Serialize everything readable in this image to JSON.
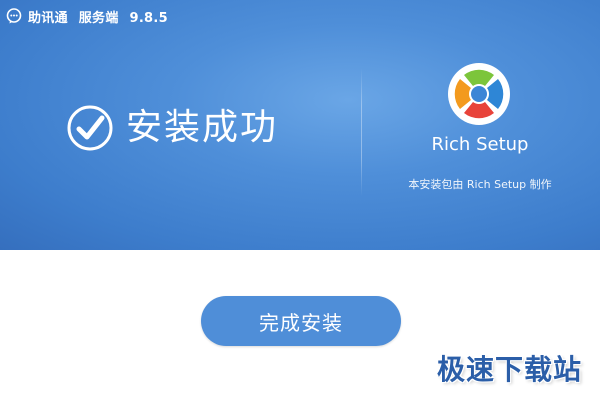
{
  "window": {
    "app_name": "助讯通",
    "edition": "服务端",
    "version": "9.8.5",
    "icon": "chat-bubble-icon"
  },
  "status": {
    "icon": "check-circle-icon",
    "text": "安装成功"
  },
  "brand": {
    "logo_icon": "rich-setup-logo-icon",
    "name": "Rich Setup",
    "credit": "本安装包由 Rich Setup 制作"
  },
  "actions": {
    "finish_label": "完成安装"
  },
  "watermark": {
    "text": "极速下载站"
  },
  "colors": {
    "header_blue": "#4f8fd9",
    "button_blue": "#4f8ed8",
    "background": "#ffffff",
    "watermark": "#2b5ea8",
    "logo_green": "#7cc53b",
    "logo_blue": "#2e86d6",
    "logo_red": "#e8433a",
    "logo_orange": "#f39a1e"
  }
}
